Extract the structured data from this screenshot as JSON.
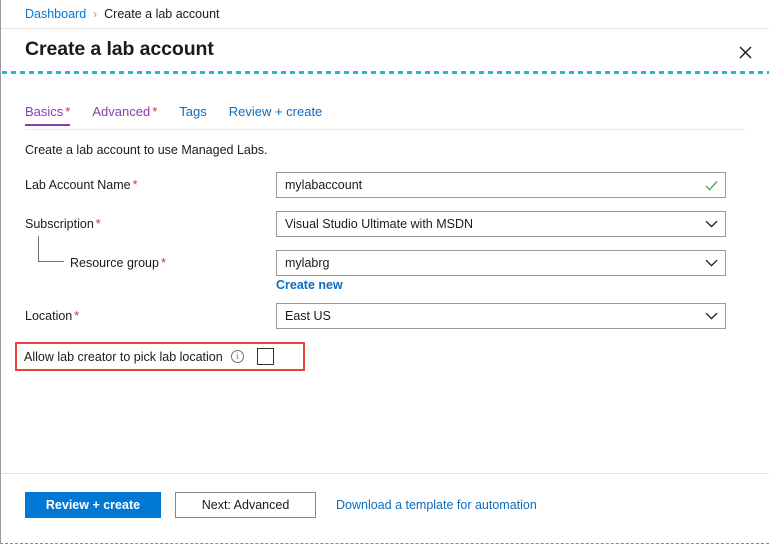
{
  "breadcrumb": {
    "parent": "Dashboard",
    "separator": "›",
    "current": "Create a lab account"
  },
  "header": {
    "title": "Create a lab account",
    "close_icon": "close-icon"
  },
  "tabs": [
    {
      "label": "Basics",
      "required": "*",
      "state": "active"
    },
    {
      "label": "Advanced",
      "required": "*",
      "state": "visited"
    },
    {
      "label": "Tags",
      "required": "",
      "state": "plain"
    },
    {
      "label": "Review + create",
      "required": "",
      "state": "plain"
    }
  ],
  "intro": "Create a lab account to use Managed Labs.",
  "fields": [
    {
      "label": "Lab Account Name",
      "required": "*",
      "value": "mylabaccount",
      "control": "text",
      "adornment": "checkmark-icon"
    },
    {
      "label": "Subscription",
      "required": "*",
      "value": "Visual Studio Ultimate with MSDN",
      "control": "select",
      "adornment": "chevron-down-icon"
    },
    {
      "label": "Resource group",
      "required": "*",
      "value": "mylabrg",
      "control": "select",
      "adornment": "chevron-down-icon",
      "sublink": "Create new"
    },
    {
      "label": "Location",
      "required": "*",
      "value": "East US",
      "control": "select",
      "adornment": "chevron-down-icon"
    }
  ],
  "highlighted_option": {
    "label": "Allow lab creator to pick lab location",
    "info_glyph": "i",
    "checked": false,
    "highlight_color": "#e8453c"
  },
  "footer": {
    "primary_button": "Review + create",
    "secondary_button": "Next: Advanced",
    "link": "Download a template for automation"
  },
  "colors": {
    "accent_blue": "#0078d4",
    "link_blue": "#0e6cbd",
    "tab_purple": "#8a3ea8",
    "required_red": "#b8384a",
    "highlight_red": "#e8453c",
    "success_green": "#4caf50",
    "divider_cyan": "#22b5ec"
  }
}
